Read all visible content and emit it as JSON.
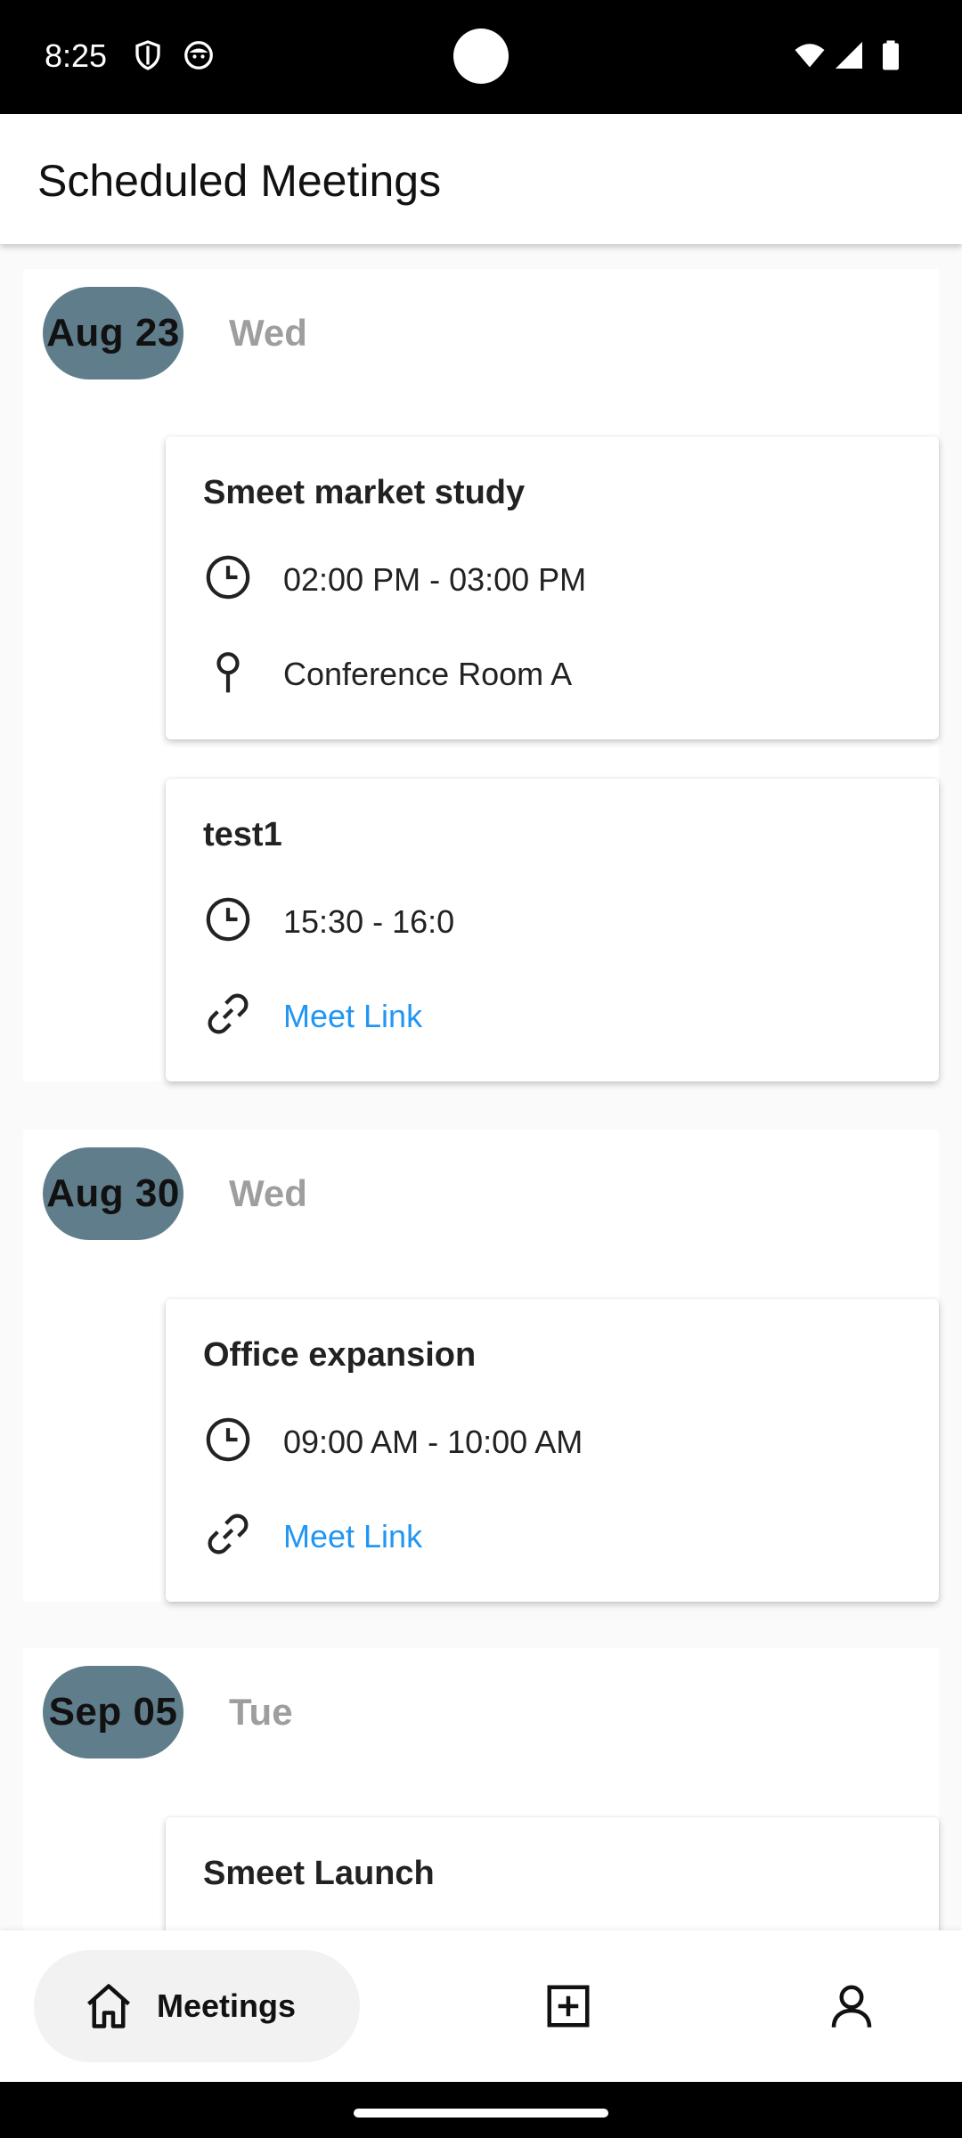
{
  "status": {
    "time": "8:25",
    "icons": [
      "shield-icon",
      "face-icon",
      "wifi-icon",
      "signal-icon",
      "battery-icon"
    ]
  },
  "app_bar": {
    "title": "Scheduled Meetings"
  },
  "days": [
    {
      "date": "Aug 23",
      "weekday": "Wed",
      "meetings": [
        {
          "title": "Smeet market study",
          "time": "02:00 PM - 03:00 PM",
          "location": "Conference Room A",
          "location_icon": "pin-icon"
        },
        {
          "title": "test1",
          "time": "15:30 - 16:0",
          "link": "Meet Link",
          "link_icon": "link-icon"
        }
      ]
    },
    {
      "date": "Aug 30",
      "weekday": "Wed",
      "meetings": [
        {
          "title": "Office expansion",
          "time": "09:00 AM - 10:00 AM",
          "link": "Meet Link",
          "link_icon": "link-icon"
        }
      ]
    },
    {
      "date": "Sep 05",
      "weekday": "Tue",
      "meetings": [
        {
          "title": "Smeet Launch"
        }
      ]
    }
  ],
  "bottom_nav": {
    "meetings_label": "Meetings",
    "icons": [
      "home-icon",
      "add-meeting-icon",
      "profile-icon"
    ]
  },
  "colors": {
    "date_pill": "#607d8b",
    "weekday": "#9e9e9e",
    "link": "#2196f3",
    "nav_active": "#f2f2f2"
  }
}
